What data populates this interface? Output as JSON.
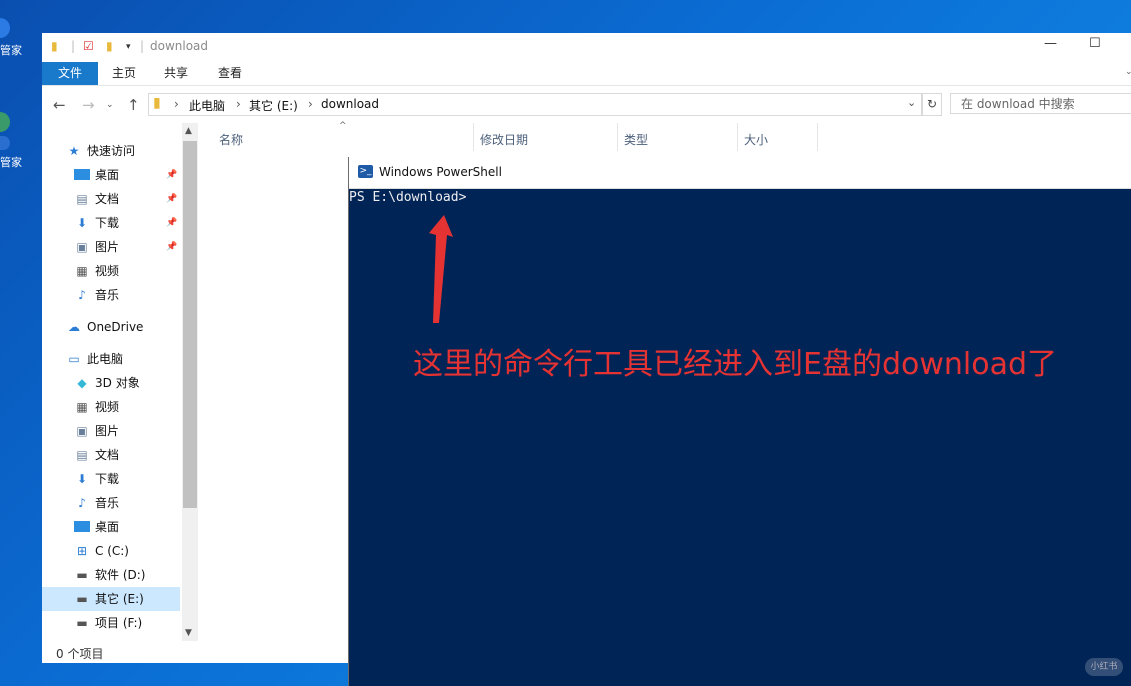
{
  "desktop": {
    "icon1_label": "管家",
    "icon2_label": "管家"
  },
  "explorer": {
    "title": "download",
    "window_controls": {
      "minimize": "—",
      "maximize": "☐"
    },
    "ribbon_tabs": [
      "文件",
      "主页",
      "共享",
      "查看"
    ],
    "breadcrumb": [
      "此电脑",
      "其它 (E:)",
      "download"
    ],
    "search_placeholder": "在 download 中搜索",
    "columns": [
      "名称",
      "修改日期",
      "类型",
      "大小"
    ],
    "nav": {
      "quick_access": "快速访问",
      "quick_items": [
        "桌面",
        "文档",
        "下载",
        "图片",
        "视频",
        "音乐"
      ],
      "onedrive": "OneDrive",
      "this_pc": "此电脑",
      "pc_items": [
        "3D 对象",
        "视频",
        "图片",
        "文档",
        "下载",
        "音乐",
        "桌面",
        "C (C:)",
        "软件 (D:)",
        "其它 (E:)",
        "项目 (F:)"
      ]
    },
    "status": "0 个项目"
  },
  "powershell": {
    "title": "Windows PowerShell",
    "prompt": "PS E:\\download>"
  },
  "annotation": "这里的命令行工具已经进入到E盘的download了",
  "watermark": "小红书",
  "colors": {
    "ps_bg": "#012456",
    "annotation": "#e53232",
    "ribbon_file": "#1979ca"
  }
}
